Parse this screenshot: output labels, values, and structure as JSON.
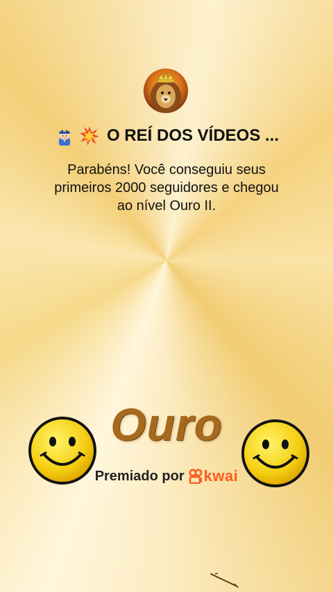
{
  "header": {
    "title": "O REÍ DOS VÍDEOS ...",
    "title_emojis": [
      "police-officer-icon",
      "collision-icon"
    ]
  },
  "message": {
    "line1": "Parabéns! Você conseguiu seus",
    "line2": "primeiros 2000 seguidores e chegou",
    "line3": "ao nível Ouro II."
  },
  "badge": {
    "level_label": "Ouro"
  },
  "award": {
    "prefix": "Premiado por",
    "brand": "kwai",
    "brand_color": "#ff5a1f"
  },
  "decor": {
    "left_icon": "smiley-face-icon",
    "right_icon": "smiley-face-icon",
    "avatar_icon": "lion-avatar-icon"
  }
}
